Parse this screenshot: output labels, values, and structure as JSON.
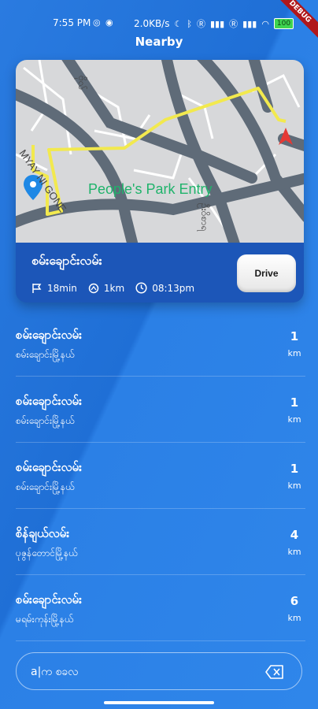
{
  "status_bar": {
    "time": "7:55 PM",
    "network_speed": "2.0KB/s",
    "battery": "100",
    "debug_label": "DEBUG"
  },
  "header": {
    "title": "Nearby"
  },
  "map_card": {
    "map_label": "People's Park Entry",
    "street_label_left": "MYAY NI GONE",
    "street_label_right": "ဦးဝိစာရ",
    "street_label_top": "ဗိုလ်",
    "place_name": "စမ်းချောင်းလမ်း",
    "trip": {
      "duration": "18min",
      "distance": "1km",
      "arrival": "08:13pm"
    },
    "drive_label": "Drive"
  },
  "list": {
    "items": [
      {
        "title": "စမ်းချောင်းလမ်း",
        "subtitle": "စမ်းချောင်းမြို့နယ်",
        "distance": "1",
        "unit": "km"
      },
      {
        "title": "စမ်းချောင်းလမ်း",
        "subtitle": "စမ်းချောင်းမြို့နယ်",
        "distance": "1",
        "unit": "km"
      },
      {
        "title": "စမ်းချောင်းလမ်း",
        "subtitle": "စမ်းချောင်းမြို့နယ်",
        "distance": "1",
        "unit": "km"
      },
      {
        "title": "စိန်ချယ်လမ်း",
        "subtitle": "ပုဇွန်တောင်မြို့နယ်",
        "distance": "4",
        "unit": "km"
      },
      {
        "title": "စမ်းချောင်းလမ်း",
        "subtitle": "မရမ်းကုန်းမြို့နယ်",
        "distance": "6",
        "unit": "km"
      }
    ]
  },
  "search": {
    "value": "a|က စခလ"
  },
  "colors": {
    "background": "#2a7be0",
    "route": "#f2e94e",
    "destination_marker": "#e53935",
    "origin_marker": "#1e88e5",
    "map_base": "#d9d9d9",
    "map_roads": "#5f6b78"
  }
}
